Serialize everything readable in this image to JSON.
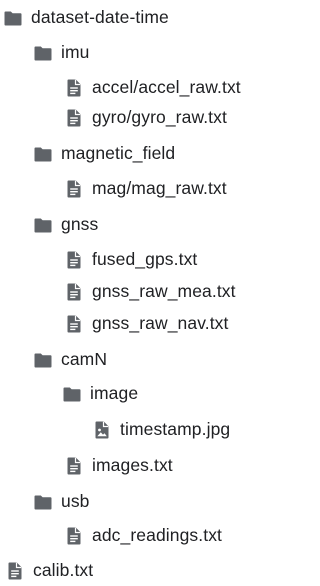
{
  "tree": {
    "root": {
      "label": "dataset-date-time",
      "icon": "folder-icon"
    },
    "imu": {
      "label": "imu",
      "icon": "folder-icon",
      "files": [
        "accel/accel_raw.txt",
        "gyro/gyro_raw.txt"
      ]
    },
    "magnetic_field": {
      "label": "magnetic_field",
      "icon": "folder-icon",
      "files": [
        "mag/mag_raw.txt"
      ]
    },
    "gnss": {
      "label": "gnss",
      "icon": "folder-icon",
      "files": [
        "fused_gps.txt",
        "gnss_raw_mea.txt",
        "gnss_raw_nav.txt"
      ]
    },
    "camN": {
      "label": "camN",
      "icon": "folder-icon",
      "image": {
        "label": "image",
        "icon": "folder-icon",
        "files": [
          "timestamp.jpg"
        ]
      },
      "files": [
        "images.txt"
      ]
    },
    "usb": {
      "label": "usb",
      "icon": "folder-icon",
      "files": [
        "adc_readings.txt"
      ]
    },
    "root_files": [
      "calib.txt"
    ]
  },
  "colors": {
    "icon": "#5f6368",
    "text": "#202124",
    "background": "#ffffff"
  }
}
